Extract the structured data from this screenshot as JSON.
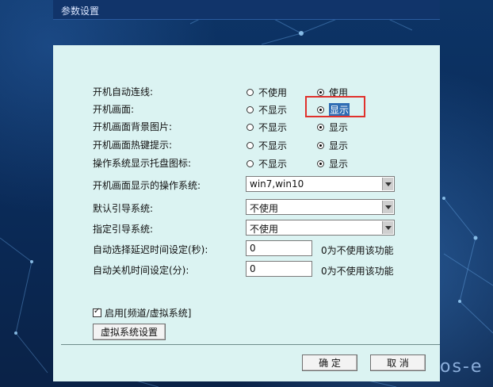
{
  "window": {
    "title": "参数设置"
  },
  "settings": {
    "autoconnect": {
      "label": "开机自动连线:",
      "opt_no": "不使用",
      "opt_yes": "使用",
      "selected": "使用"
    },
    "boot_screen": {
      "label": "开机画面:",
      "opt_no": "不显示",
      "opt_yes": "显示",
      "selected": "显示"
    },
    "boot_bg": {
      "label": "开机画面背景图片:",
      "opt_no": "不显示",
      "opt_yes": "显示",
      "selected": "显示"
    },
    "boot_hotkey": {
      "label": "开机画面热键提示:",
      "opt_no": "不显示",
      "opt_yes": "显示",
      "selected": "显示"
    },
    "tray_icon": {
      "label": "操作系统显示托盘图标:",
      "opt_no": "不显示",
      "opt_yes": "显示",
      "selected": "显示"
    }
  },
  "os_display": {
    "label": "开机画面显示的操作系统:",
    "value": "win7,win10"
  },
  "default_boot": {
    "label": "默认引导系统:",
    "value": "不使用"
  },
  "specified_boot": {
    "label": "指定引导系统:",
    "value": "不使用"
  },
  "auto_delay": {
    "label": "自动选择延迟时间设定(秒):",
    "value": "0",
    "hint": "0为不使用该功能"
  },
  "auto_shutdown": {
    "label": "自动关机时间设定(分):",
    "value": "0",
    "hint": "0为不使用该功能"
  },
  "channel_checkbox": {
    "label": "启用[频道/虚拟系统]",
    "checked": true
  },
  "buttons": {
    "virtual_settings": "虚拟系统设置",
    "ok": "确 定",
    "cancel": "取 消"
  },
  "background": {
    "brand": "os-e"
  }
}
